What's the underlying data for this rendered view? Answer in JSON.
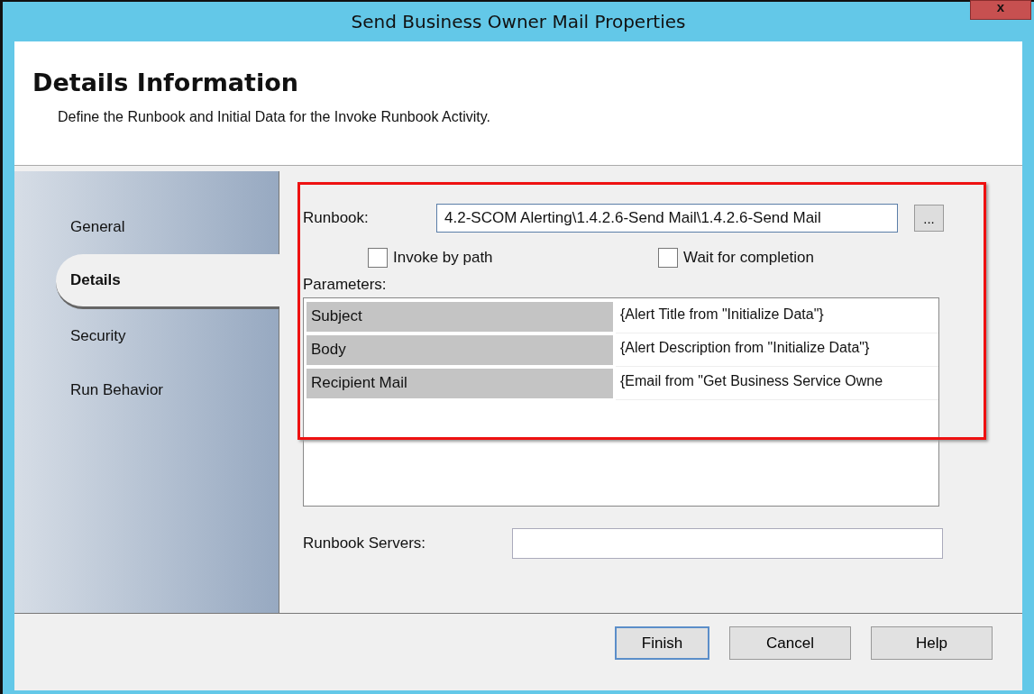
{
  "window": {
    "title": "Send Business Owner Mail Properties",
    "close_glyph": "x"
  },
  "header": {
    "title": "Details Information",
    "description": "Define the Runbook and Initial Data for the Invoke Runbook Activity."
  },
  "sidebar": {
    "items": [
      {
        "label": "General",
        "selected": false
      },
      {
        "label": "Details",
        "selected": true
      },
      {
        "label": "Security",
        "selected": false
      },
      {
        "label": "Run Behavior",
        "selected": false
      }
    ]
  },
  "runbook": {
    "label": "Runbook:",
    "value": "4.2-SCOM Alerting\\1.4.2.6-Send Mail\\1.4.2.6-Send Mail",
    "browse": "..."
  },
  "checkboxes": [
    {
      "label": "Invoke by path",
      "checked": false
    },
    {
      "label": "Wait for completion",
      "checked": false
    }
  ],
  "parameters": {
    "label": "Parameters:",
    "rows": [
      {
        "name": "Subject",
        "value": "{Alert Title from \"Initialize Data\"}"
      },
      {
        "name": "Body",
        "value": "{Alert Description from \"Initialize Data\"}"
      },
      {
        "name": "Recipient Mail",
        "value": "{Email from \"Get Business Service Owne"
      }
    ]
  },
  "servers": {
    "label": "Runbook Servers:"
  },
  "buttons": [
    {
      "label": "Finish",
      "default": true
    },
    {
      "label": "Cancel",
      "default": false
    },
    {
      "label": "Help",
      "default": false
    }
  ]
}
